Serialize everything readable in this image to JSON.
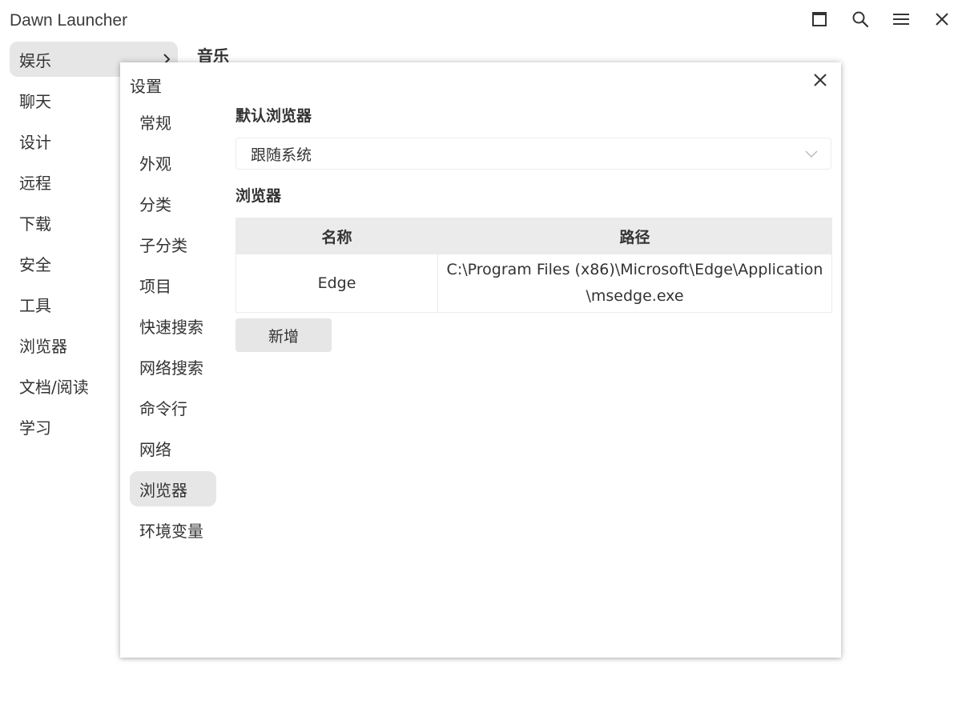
{
  "app": {
    "title": "Dawn Launcher"
  },
  "window_controls": [
    {
      "name": "maximize-icon"
    },
    {
      "name": "search-icon"
    },
    {
      "name": "menu-icon"
    },
    {
      "name": "close-icon"
    }
  ],
  "sidebar": {
    "items": [
      {
        "label": "娱乐",
        "active": true
      },
      {
        "label": "聊天"
      },
      {
        "label": "设计"
      },
      {
        "label": "远程"
      },
      {
        "label": "下载"
      },
      {
        "label": "安全"
      },
      {
        "label": "工具"
      },
      {
        "label": "浏览器"
      },
      {
        "label": "文档/阅读"
      },
      {
        "label": "学习"
      }
    ]
  },
  "main": {
    "heading": "音乐"
  },
  "settings": {
    "title": "设置",
    "nav": [
      {
        "label": "常规"
      },
      {
        "label": "外观"
      },
      {
        "label": "分类"
      },
      {
        "label": "子分类"
      },
      {
        "label": "项目"
      },
      {
        "label": "快速搜索"
      },
      {
        "label": "网络搜索"
      },
      {
        "label": "命令行"
      },
      {
        "label": "网络"
      },
      {
        "label": "浏览器",
        "active": true
      },
      {
        "label": "环境变量"
      }
    ],
    "default_browser": {
      "label": "默认浏览器",
      "value": "跟随系统"
    },
    "browsers": {
      "label": "浏览器",
      "columns": [
        "名称",
        "路径"
      ],
      "rows": [
        [
          "Edge",
          "C:\\Program Files (x86)\\Microsoft\\Edge\\Application\\msedge.exe"
        ]
      ],
      "add_label": "新增"
    }
  },
  "colors": {
    "active_bg": "#e6e6e6",
    "header_bg": "#ebebeb",
    "text": "#333333"
  }
}
